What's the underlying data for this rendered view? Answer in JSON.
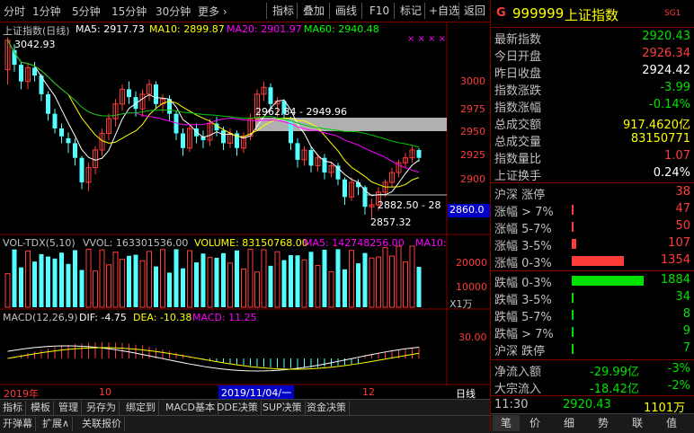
{
  "toolbar": {
    "periods": [
      "分时",
      "1分钟",
      "5分钟",
      "15分钟",
      "30分钟",
      "更多 ›"
    ],
    "buttons": [
      "指标",
      "叠加",
      "画线",
      "F10",
      "标记",
      "+自选",
      "返回"
    ]
  },
  "chart": {
    "index_label": "上证指数(日线)",
    "ma": [
      {
        "label": "MA5: 2917.73",
        "color": "#ffffff"
      },
      {
        "label": "MA10: 2899.87",
        "color": "#ffff00"
      },
      {
        "label": "MA20: 2901.97",
        "color": "#ff00ff"
      },
      {
        "label": "MA60: 2940.48",
        "color": "#00ff00"
      }
    ],
    "dots": "× × × ×",
    "high_label": "3042.93",
    "gap_label": "2962.84 - 2949.96",
    "gap2_label": "2882.50 - 28",
    "low_label": "2857.32",
    "price_axis": [
      "3000",
      "2975",
      "2950",
      "2925",
      "2900"
    ],
    "cursor_price": "2860.0",
    "vol_label": "VOL-TDX(5,10)",
    "vvol": "VVOL: 163301536.00",
    "volume": "VOLUME: 83150768.00",
    "vol_ma5": "MA5: 142748256.00",
    "vol_ma10": "MA10:",
    "vol_axis": [
      "20000",
      "10000"
    ],
    "vol_unit": "X1万",
    "macd_label": "MACD(12,26,9)",
    "dif": "DIF: -4.75",
    "dea": "DEA: -10.38",
    "macd": "MACD: 11.25",
    "macd_axis": "30.00",
    "date_axis": [
      "2019年",
      "10",
      "12"
    ],
    "date_cursor": "2019/11/04/一",
    "period_label": "日线",
    "candles": [
      [
        3010,
        3040,
        3000,
        3043,
        2995
      ],
      [
        3030,
        3015,
        3012,
        3036,
        3008
      ],
      [
        3015,
        2998,
        2995,
        3018,
        2990
      ],
      [
        2998,
        3012,
        2992,
        3016,
        2990
      ],
      [
        3012,
        3004,
        3000,
        3018,
        2998
      ],
      [
        3004,
        2985,
        2982,
        3006,
        2978
      ],
      [
        2985,
        2965,
        2960,
        2988,
        2958
      ],
      [
        2965,
        2950,
        2948,
        2970,
        2945
      ],
      [
        2950,
        2942,
        2938,
        2955,
        2935
      ],
      [
        2940,
        2935,
        2930,
        2946,
        2925
      ],
      [
        2935,
        2920,
        2915,
        2940,
        2912
      ],
      [
        2920,
        2895,
        2890,
        2922,
        2888
      ],
      [
        2895,
        2910,
        2892,
        2915,
        2886
      ],
      [
        2910,
        2928,
        2905,
        2932,
        2903
      ],
      [
        2928,
        2945,
        2925,
        2950,
        2922
      ],
      [
        2945,
        2960,
        2940,
        2965,
        2938
      ],
      [
        2960,
        2975,
        2955,
        2980,
        2952
      ],
      [
        2975,
        2990,
        2970,
        2995,
        2968
      ],
      [
        2990,
        2982,
        2978,
        2998,
        2975
      ],
      [
        2982,
        2970,
        2966,
        2988,
        2962
      ],
      [
        2970,
        2985,
        2965,
        2990,
        2962
      ],
      [
        2985,
        2995,
        2980,
        3000,
        2978
      ],
      [
        2995,
        2975,
        2972,
        2998,
        2970
      ],
      [
        2975,
        2980,
        2968,
        2985,
        2966
      ],
      [
        2980,
        2965,
        2960,
        2984,
        2958
      ],
      [
        2965,
        2945,
        2940,
        2968,
        2938
      ],
      [
        2945,
        2930,
        2925,
        2950,
        2922
      ],
      [
        2930,
        2950,
        2928,
        2955,
        2926
      ],
      [
        2950,
        2942,
        2938,
        2955,
        2935
      ],
      [
        2942,
        2938,
        2932,
        2948,
        2930
      ],
      [
        2938,
        2955,
        2935,
        2960,
        2932
      ],
      [
        2955,
        2948,
        2945,
        2962,
        2942
      ],
      [
        2948,
        2935,
        2930,
        2952,
        2928
      ],
      [
        2935,
        2945,
        2932,
        2950,
        2930
      ],
      [
        2945,
        2930,
        2926,
        2948,
        2922
      ],
      [
        2930,
        2942,
        2928,
        2946,
        2925
      ],
      [
        2942,
        2960,
        2940,
        2965,
        2938
      ],
      [
        2960,
        2985,
        2958,
        2990,
        2955
      ],
      [
        2985,
        2992,
        2980,
        2998,
        2978
      ],
      [
        2992,
        2975,
        2970,
        2996,
        2968
      ],
      [
        2975,
        2978,
        2965,
        2982,
        2962
      ],
      [
        2978,
        2965,
        2960,
        2980,
        2958
      ],
      [
        2958,
        2935,
        2930,
        2962,
        2928
      ],
      [
        2935,
        2918,
        2912,
        2940,
        2910
      ],
      [
        2918,
        2928,
        2915,
        2932,
        2912
      ],
      [
        2928,
        2912,
        2908,
        2932,
        2905
      ],
      [
        2912,
        2920,
        2908,
        2924,
        2906
      ],
      [
        2920,
        2905,
        2900,
        2924,
        2898
      ],
      [
        2905,
        2912,
        2902,
        2916,
        2900
      ],
      [
        2912,
        2898,
        2895,
        2915,
        2892
      ],
      [
        2898,
        2880,
        2875,
        2900,
        2872
      ],
      [
        2880,
        2895,
        2878,
        2900,
        2876
      ],
      [
        2895,
        2890,
        2885,
        2898,
        2882
      ],
      [
        2890,
        2870,
        2865,
        2892,
        2862
      ],
      [
        2870,
        2872,
        2860,
        2878,
        2857
      ],
      [
        2872,
        2885,
        2868,
        2890,
        2866
      ],
      [
        2885,
        2895,
        2882,
        2898,
        2880
      ],
      [
        2895,
        2905,
        2892,
        2910,
        2890
      ],
      [
        2905,
        2915,
        2902,
        2918,
        2900
      ],
      [
        2915,
        2920,
        2912,
        2925,
        2910
      ],
      [
        2920,
        2928,
        2918,
        2932,
        2915
      ],
      [
        2928,
        2920,
        2918,
        2930,
        2916
      ]
    ]
  },
  "right": {
    "code": "999999",
    "name": "上证指数",
    "flag": "G",
    "tag": "SG1",
    "rows": [
      {
        "k": "最新指数",
        "v": "2920.43",
        "c": "green"
      },
      {
        "k": "今日开盘",
        "v": "2926.34",
        "c": "red"
      },
      {
        "k": "昨日收盘",
        "v": "2924.42",
        "c": "white"
      },
      {
        "k": "指数涨跌",
        "v": "-3.99",
        "c": "green"
      },
      {
        "k": "指数涨幅",
        "v": "-0.14%",
        "c": "green"
      },
      {
        "k": "总成交额",
        "v": "917.4620亿",
        "c": "yellow"
      },
      {
        "k": "总成交量",
        "v": "83150771",
        "c": "yellow"
      },
      {
        "k": "指数量比",
        "v": "1.07",
        "c": "red"
      },
      {
        "k": "上证换手",
        "v": "0.24%",
        "c": "white"
      }
    ],
    "up": [
      {
        "k": "沪深 涨停",
        "v": "38",
        "frac": 0.0
      },
      {
        "k": "涨幅 > 7%",
        "v": "47",
        "frac": 0.01
      },
      {
        "k": "涨幅 5-7%",
        "v": "50",
        "frac": 0.01
      },
      {
        "k": "涨幅 3-5%",
        "v": "107",
        "frac": 0.06
      },
      {
        "k": "涨幅 0-3%",
        "v": "1354",
        "frac": 0.72
      }
    ],
    "down": [
      {
        "k": "跌幅 0-3%",
        "v": "1884",
        "frac": 1.0
      },
      {
        "k": "跌幅 3-5%",
        "v": "34",
        "frac": 0.0
      },
      {
        "k": "跌幅 5-7%",
        "v": "8",
        "frac": 0.0
      },
      {
        "k": "跌幅 > 7%",
        "v": "9",
        "frac": 0.0
      },
      {
        "k": "沪深 跌停",
        "v": "7",
        "frac": 0.0
      }
    ],
    "flow": [
      {
        "k": "净流入额",
        "v": "-29.99亿",
        "p": "-3%"
      },
      {
        "k": "大宗流入",
        "v": "-18.42亿",
        "p": "-2%"
      }
    ],
    "time": "11:30",
    "price": "2920.43",
    "vol": "1101万",
    "tabs": [
      "笔",
      "价",
      "细",
      "势",
      "联",
      "值"
    ]
  },
  "bottom": {
    "row1": [
      "指标",
      "模板",
      "管理",
      "另存为",
      "绑定到",
      "MACD基本",
      "DDE决策",
      "SUP决策",
      "资金决策"
    ],
    "row2": [
      "开弹幕",
      "扩展∧",
      "关联报价"
    ]
  }
}
